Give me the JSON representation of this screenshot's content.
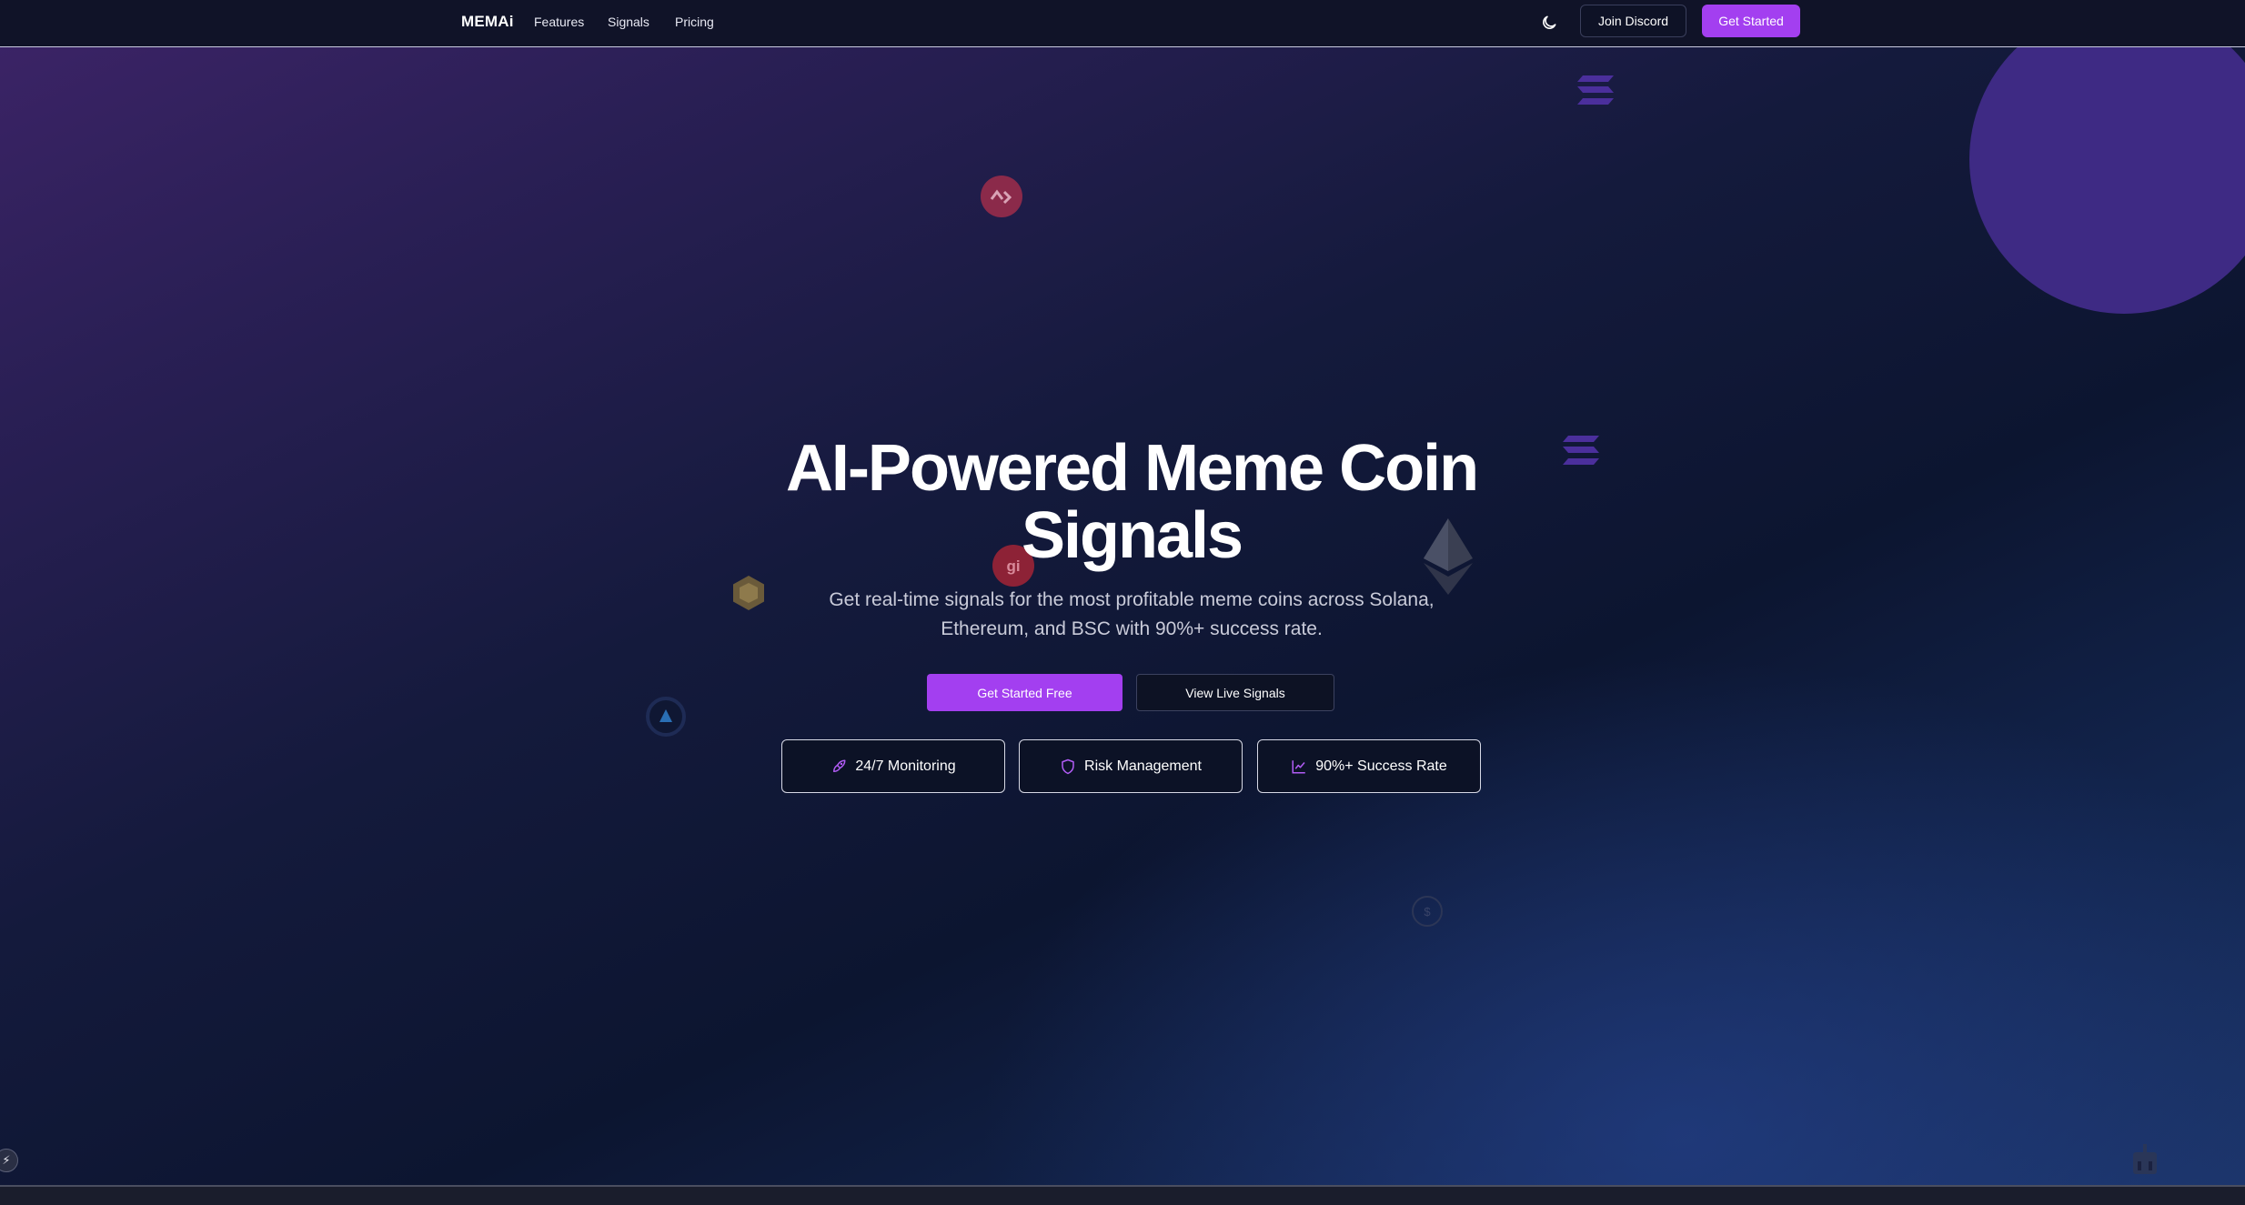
{
  "nav": {
    "logo": "MEMAi",
    "links": [
      "Features",
      "Signals",
      "Pricing"
    ],
    "discord_label": "Join Discord",
    "start_label": "Get Started"
  },
  "hero": {
    "title_line1": "AI-Powered Meme Coin",
    "title_line2": "Signals",
    "subtitle_line1": "Get real-time signals for the most profitable meme coins across Solana,",
    "subtitle_line2": "Ethereum, and BSC with 90%+ success rate.",
    "primary_cta": "Get Started Free",
    "secondary_cta": "View Live Signals"
  },
  "features": [
    {
      "label": "24/7 Monitoring",
      "icon": "rocket-icon"
    },
    {
      "label": "Risk Management",
      "icon": "shield-icon"
    },
    {
      "label": "90%+ Success Rate",
      "icon": "trend-chart-icon"
    }
  ],
  "colors": {
    "accent": "#a33ff0",
    "nav_bg": "#101328",
    "circle": "#3e2a84"
  },
  "decorations": [
    "solana-icon",
    "solana-icon",
    "ethereum-icon",
    "meme-coin-icon",
    "meme-coin-icon",
    "bnb-icon",
    "arbitrum-icon",
    "coin-icon",
    "bot-icon"
  ]
}
